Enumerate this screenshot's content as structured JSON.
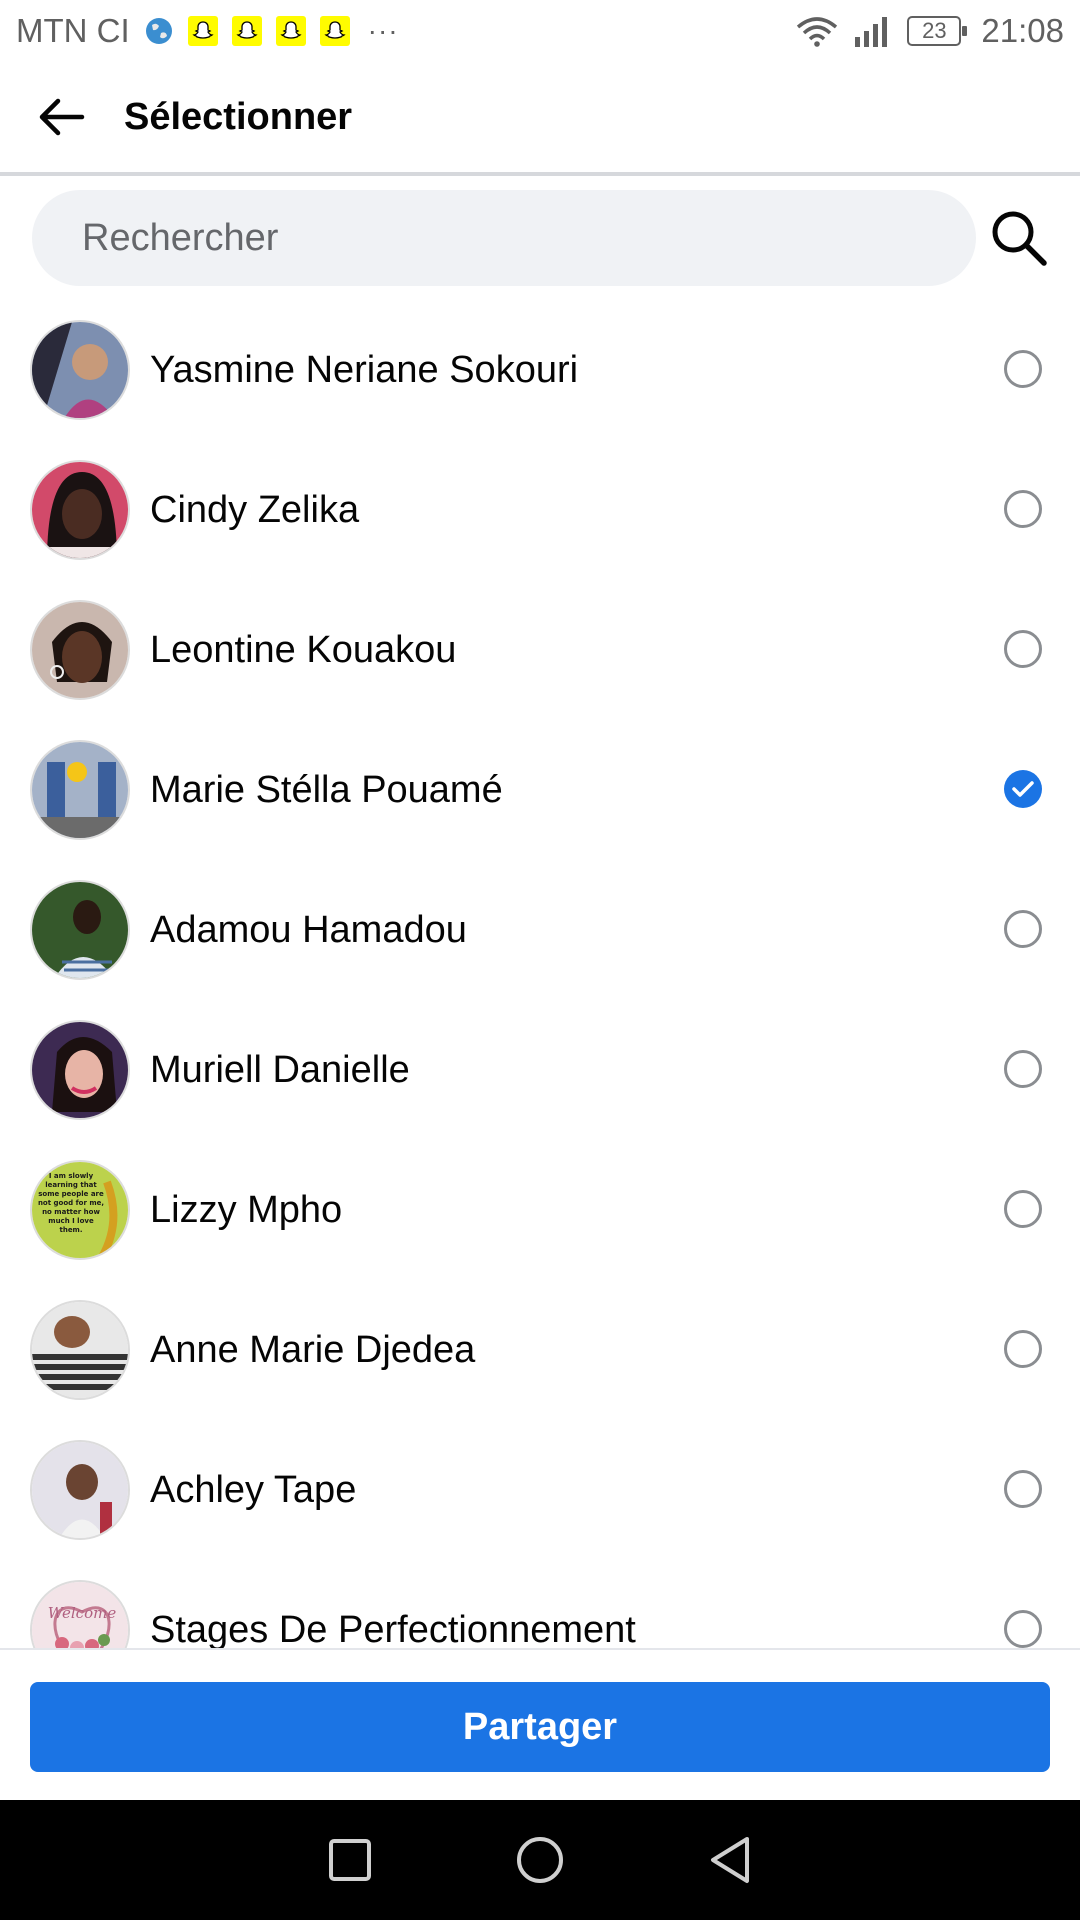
{
  "status_bar": {
    "carrier": "MTN CI",
    "more_indicator": "···",
    "battery_level": "23",
    "time": "21:08",
    "notification_icons": [
      "globe-icon",
      "snapchat-icon",
      "snapchat-icon",
      "snapchat-icon",
      "snapchat-icon"
    ]
  },
  "header": {
    "back_icon": "arrow-left-icon",
    "title": "Sélectionner"
  },
  "search": {
    "placeholder": "Rechercher",
    "value": "",
    "icon": "search-icon"
  },
  "contacts": [
    {
      "name": "Yasmine Neriane Sokouri",
      "selected": false,
      "avatar_bg": "#6f7f9e"
    },
    {
      "name": "Cindy Zelika",
      "selected": false,
      "avatar_bg": "#5a3a3a"
    },
    {
      "name": "Leontine Kouakou",
      "selected": false,
      "avatar_bg": "#b9a39a"
    },
    {
      "name": "Marie Stélla Pouamé",
      "selected": true,
      "avatar_bg": "#8c97b0"
    },
    {
      "name": "Adamou Hamadou",
      "selected": false,
      "avatar_bg": "#3f5f34"
    },
    {
      "name": "Muriell Danielle",
      "selected": false,
      "avatar_bg": "#a6728a"
    },
    {
      "name": "Lizzy Mpho",
      "selected": false,
      "avatar_bg": "#b8cf4a"
    },
    {
      "name": "Anne Marie Djedea",
      "selected": false,
      "avatar_bg": "#c8c8c8"
    },
    {
      "name": "Achley Tape",
      "selected": false,
      "avatar_bg": "#d9d6e0"
    },
    {
      "name": "Stages De Perfectionnement",
      "selected": false,
      "avatar_bg": "#e9c9d1"
    }
  ],
  "lizzy_avatar_text": "I am slowly learning that some people are not good for me, no matter how much I love them.",
  "stages_avatar_text": "Welcome",
  "footer": {
    "share_label": "Partager"
  },
  "nav_bar": {
    "icons": [
      "recent-apps-icon",
      "home-icon",
      "back-triangle-icon"
    ]
  },
  "colors": {
    "accent": "#1b74e4",
    "search_bg": "#f0f2f5",
    "radio_border": "#8a8d91"
  }
}
